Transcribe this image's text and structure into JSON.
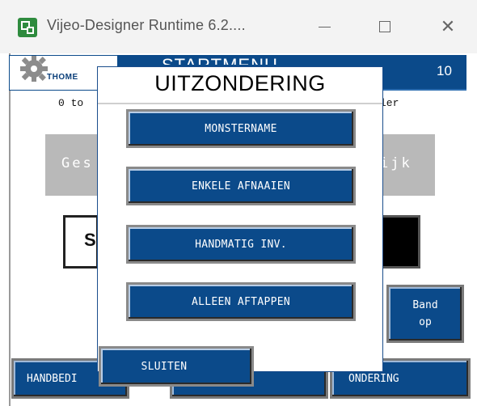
{
  "window": {
    "title": "Vijeo-Designer Runtime 6.2....",
    "icon": "vijeo-app-icon",
    "controls": {
      "minimize_icon": "minimize-icon",
      "maximize_icon": "maximize-icon",
      "close_glyph": "✕"
    }
  },
  "hmi": {
    "brand": "THOME",
    "screen_title": "STARTMENU",
    "screen_number": "10",
    "line_left": "0 to",
    "line_right": "ler",
    "grey_left": "Ges",
    "grey_right": "ijk",
    "white_box_char": "S",
    "band_line1": "Band",
    "band_line2": "op",
    "bottom_left": "HANDBEDI",
    "bottom_right": "ONDERING"
  },
  "popup": {
    "title": "UITZONDERING",
    "buttons": [
      "MONSTERNAME",
      "ENKELE AFNAAIEN",
      "HANDMATIG INV.",
      "ALLEEN AFTAPPEN"
    ],
    "close_label": "SLUITEN"
  },
  "colors": {
    "hmi_blue": "#0b4a8a",
    "app_icon_green": "#2e8b3e",
    "grey_panel": "#b9b9b9"
  }
}
